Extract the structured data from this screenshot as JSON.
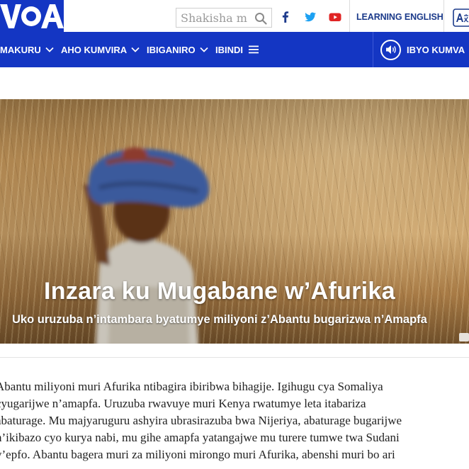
{
  "site": {
    "logo_text": "VOA"
  },
  "search": {
    "placeholder": "Shakisha m"
  },
  "social": {
    "items": [
      "facebook",
      "twitter",
      "youtube"
    ],
    "colors": {
      "facebook": "#1d3a8c",
      "twitter": "#1da1f2",
      "youtube": "#e02424"
    }
  },
  "header": {
    "learning_english": "LEARNING ENGLISH"
  },
  "nav": {
    "items": [
      {
        "label": "MAKURU"
      },
      {
        "label": "AHO KUMVIRA"
      },
      {
        "label": "IBIGANIRO"
      },
      {
        "label": "IBINDI"
      }
    ],
    "listen_label": "IBYO KUMVA"
  },
  "hero": {
    "title": "Inzara ku Mugabane w’Afurika",
    "subtitle": "Uko uruzuba n’intambara byatumye miliyoni z’Abantu bugarizwa n’Amapfa"
  },
  "article": {
    "lines": [
      "Abantu miliyoni muri Afurika ntibagira ibiribwa bihagije. Igihugu cya Somaliya",
      "cyugarijwe n’amapfa. Uruzuba rwavuye muri Kenya rwatumye leta itabariza",
      "abaturage. Mu majyaruguru ashyira ubrasirazuba bwa Nijeriya, abaturage bugarijwe",
      "n’ikibazo cyo kurya nabi, mu gihe amapfa yatangajwe mu turere tumwe twa Sudani",
      "y’epfo. Abantu bagera muri za miliyoni mirongo muri Afurika, abenshi muri bo ari"
    ]
  },
  "colors": {
    "nav_bg": "#1436c3",
    "brand_blue": "#1b3a8a"
  }
}
